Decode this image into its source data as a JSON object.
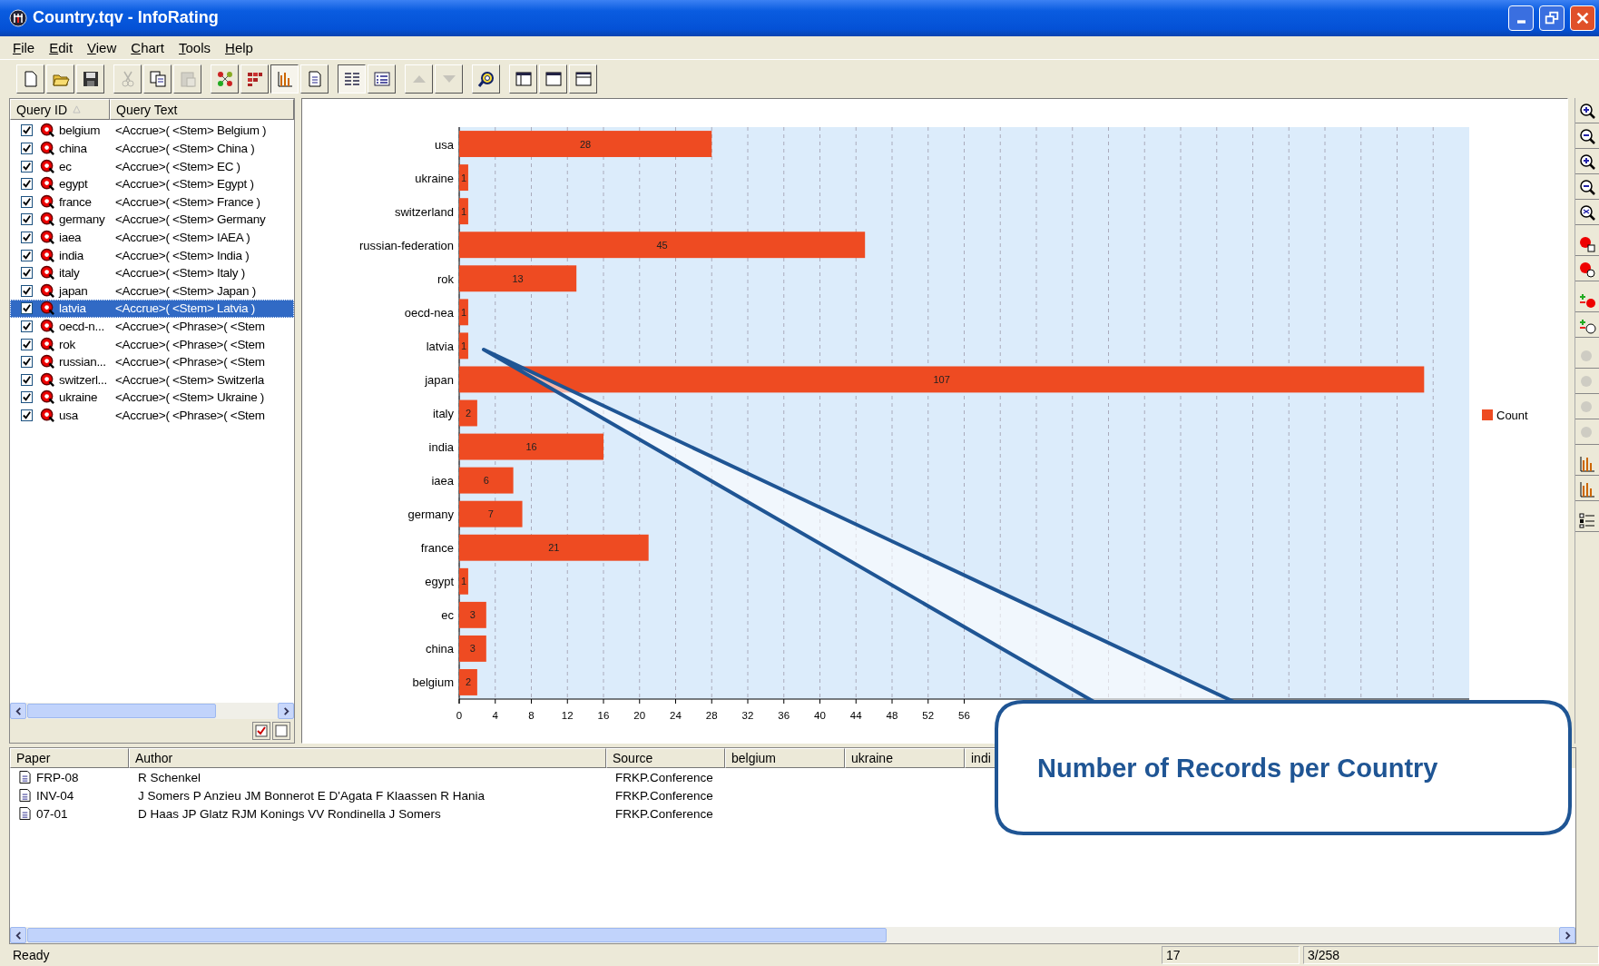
{
  "window": {
    "title": "Country.tqv - InfoRating"
  },
  "menu": [
    "File",
    "Edit",
    "View",
    "Chart",
    "Tools",
    "Help"
  ],
  "toolbar": [
    [
      {
        "kind": "new",
        "disabled": false,
        "pressed": false
      },
      {
        "kind": "open",
        "disabled": false,
        "pressed": false
      },
      {
        "kind": "save",
        "disabled": false,
        "pressed": false
      }
    ],
    [
      {
        "kind": "cut",
        "disabled": true,
        "pressed": false
      },
      {
        "kind": "copy",
        "disabled": false,
        "pressed": false
      },
      {
        "kind": "paste",
        "disabled": true,
        "pressed": false
      }
    ],
    [
      {
        "kind": "network",
        "disabled": false,
        "pressed": false
      },
      {
        "kind": "matrix",
        "disabled": false,
        "pressed": false
      },
      {
        "kind": "chart",
        "disabled": false,
        "pressed": true
      },
      {
        "kind": "document",
        "disabled": false,
        "pressed": false
      }
    ],
    [
      {
        "kind": "details",
        "disabled": false,
        "pressed": true
      },
      {
        "kind": "list",
        "disabled": false,
        "pressed": false
      }
    ],
    [
      {
        "kind": "up",
        "disabled": true,
        "pressed": false
      },
      {
        "kind": "down",
        "disabled": true,
        "pressed": false
      }
    ],
    [
      {
        "kind": "search",
        "disabled": false,
        "pressed": false
      }
    ],
    [
      {
        "kind": "pane-left",
        "disabled": false,
        "pressed": false
      },
      {
        "kind": "pane-full",
        "disabled": false,
        "pressed": false
      },
      {
        "kind": "pane-top",
        "disabled": false,
        "pressed": false
      }
    ]
  ],
  "query_list": {
    "columns": [
      {
        "label": "Query ID",
        "sorted": true
      },
      {
        "label": "Query Text",
        "sorted": false
      }
    ],
    "rows": [
      {
        "id": "belgium",
        "text": "<Accrue>( <Stem> Belgium )",
        "checked": true,
        "selected": false
      },
      {
        "id": "china",
        "text": "<Accrue>( <Stem> China )",
        "checked": true,
        "selected": false
      },
      {
        "id": "ec",
        "text": "<Accrue>( <Stem> EC )",
        "checked": true,
        "selected": false
      },
      {
        "id": "egypt",
        "text": "<Accrue>( <Stem> Egypt )",
        "checked": true,
        "selected": false
      },
      {
        "id": "france",
        "text": "<Accrue>( <Stem> France )",
        "checked": true,
        "selected": false
      },
      {
        "id": "germany",
        "text": "<Accrue>( <Stem> Germany",
        "checked": true,
        "selected": false
      },
      {
        "id": "iaea",
        "text": "<Accrue>( <Stem> IAEA )",
        "checked": true,
        "selected": false
      },
      {
        "id": "india",
        "text": "<Accrue>( <Stem> India )",
        "checked": true,
        "selected": false
      },
      {
        "id": "italy",
        "text": "<Accrue>( <Stem> Italy )",
        "checked": true,
        "selected": false
      },
      {
        "id": "japan",
        "text": "<Accrue>( <Stem> Japan )",
        "checked": true,
        "selected": false
      },
      {
        "id": "latvia",
        "text": "<Accrue>( <Stem> Latvia )",
        "checked": true,
        "selected": true
      },
      {
        "id": "oecd-n...",
        "text": "<Accrue>( <Phrase>( <Stem",
        "checked": true,
        "selected": false
      },
      {
        "id": "rok",
        "text": "<Accrue>( <Phrase>( <Stem",
        "checked": true,
        "selected": false
      },
      {
        "id": "russian...",
        "text": "<Accrue>( <Phrase>( <Stem",
        "checked": true,
        "selected": false
      },
      {
        "id": "switzerl...",
        "text": "<Accrue>( <Stem> Switzerla",
        "checked": true,
        "selected": false
      },
      {
        "id": "ukraine",
        "text": "<Accrue>( <Stem> Ukraine )",
        "checked": true,
        "selected": false
      },
      {
        "id": "usa",
        "text": "<Accrue>( <Phrase>( <Stem",
        "checked": true,
        "selected": false
      }
    ]
  },
  "chart": {
    "chart_data": {
      "type": "bar",
      "orientation": "horizontal",
      "categories": [
        "usa",
        "ukraine",
        "switzerland",
        "russian-federation",
        "rok",
        "oecd-nea",
        "latvia",
        "japan",
        "italy",
        "india",
        "iaea",
        "germany",
        "france",
        "egypt",
        "ec",
        "china",
        "belgium"
      ],
      "series": [
        {
          "name": "Count",
          "color": "#ee4b22",
          "values": [
            28,
            1,
            1,
            45,
            13,
            1,
            1,
            107,
            2,
            16,
            6,
            7,
            21,
            1,
            3,
            3,
            2
          ]
        }
      ],
      "xlim": [
        0,
        112
      ],
      "xticks": [
        0,
        4,
        8,
        12,
        16,
        20,
        24,
        28,
        32,
        36,
        40,
        44,
        48,
        52,
        56
      ],
      "grid": true,
      "data_labels": true
    }
  },
  "right_toolbar": [
    [
      {
        "kind": "zoom-in-x",
        "disabled": false
      },
      {
        "kind": "zoom-out-x",
        "disabled": false
      },
      {
        "kind": "zoom-in",
        "disabled": false
      },
      {
        "kind": "zoom-out",
        "disabled": false
      },
      {
        "kind": "zoom-fit",
        "disabled": false
      }
    ],
    [
      {
        "kind": "node-doc",
        "disabled": false
      },
      {
        "kind": "node-db",
        "disabled": false
      }
    ],
    [
      {
        "kind": "add-node",
        "disabled": false
      },
      {
        "kind": "add-db",
        "disabled": false
      }
    ],
    [
      {
        "kind": "dot",
        "disabled": true
      },
      {
        "kind": "dot",
        "disabled": true
      },
      {
        "kind": "dot",
        "disabled": true
      },
      {
        "kind": "dot",
        "disabled": true
      }
    ],
    [
      {
        "kind": "chart",
        "disabled": false
      },
      {
        "kind": "chart",
        "disabled": false
      }
    ],
    [
      {
        "kind": "legend",
        "disabled": false
      }
    ]
  ],
  "results": {
    "columns": [
      "Paper",
      "Author",
      "Source",
      "belgium",
      "ukraine",
      "indi"
    ],
    "rows": [
      {
        "paper": "FRP-08",
        "author": "R Schenkel",
        "source": "FRKP.Conference"
      },
      {
        "paper": "INV-04",
        "author": "J Somers P Anzieu JM Bonnerot E D'Agata F Klaassen R Hania",
        "source": "FRKP.Conference"
      },
      {
        "paper": "07-01",
        "author": "D Haas JP Glatz RJM Konings VV Rondinella J Somers",
        "source": "FRKP.Conference"
      }
    ]
  },
  "callout": {
    "text": "Number of Records per Country"
  },
  "status_bar": {
    "message": "Ready",
    "count": "17",
    "position": "3/258"
  }
}
